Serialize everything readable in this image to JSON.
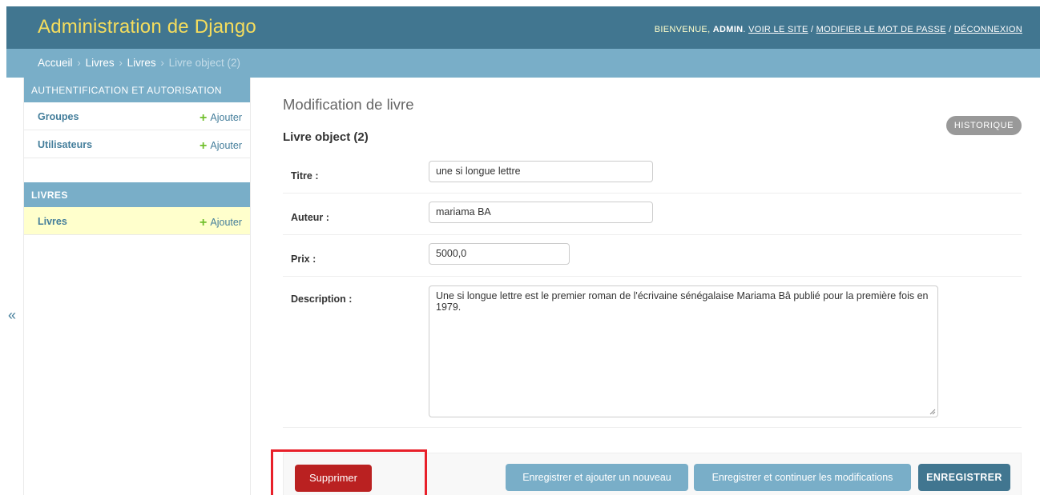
{
  "header": {
    "site_title": "Administration de Django",
    "welcome": "BIENVENUE, ",
    "user": "ADMIN",
    "view_site": "VOIR LE SITE",
    "change_password": "MODIFIER LE MOT DE PASSE",
    "logout": "DÉCONNEXION",
    "separator": " / ",
    "colors": {
      "bg": "#417690",
      "title": "#f5dd5d"
    }
  },
  "breadcrumbs": {
    "home": "Accueil",
    "app": "Livres",
    "model": "Livres",
    "current": "Livre object (2)",
    "sep": "›"
  },
  "sidebar": {
    "toggle_icon": "«",
    "modules": [
      {
        "caption": "AUTHENTIFICATION ET AUTORISATION",
        "models": [
          {
            "name": "Groupes",
            "add_label": "Ajouter"
          },
          {
            "name": "Utilisateurs",
            "add_label": "Ajouter"
          }
        ]
      },
      {
        "caption": "LIVRES",
        "models": [
          {
            "name": "Livres",
            "add_label": "Ajouter",
            "selected": true
          }
        ]
      }
    ]
  },
  "main": {
    "title": "Modification de livre",
    "object_title": "Livre object (2)",
    "history_label": "HISTORIQUE",
    "fields": [
      {
        "label": "Titre :",
        "value": "une si longue lettre"
      },
      {
        "label": "Auteur :",
        "value": "mariama BA"
      },
      {
        "label": "Prix :",
        "value": "5000,0"
      },
      {
        "label": "Description :",
        "value": "Une si longue lettre est le premier roman de l'écrivaine sénégalaise Mariama Bâ publié pour la première fois en 1979."
      }
    ]
  },
  "submit_row": {
    "delete_label": "Supprimer",
    "save_add_label": "Enregistrer et ajouter un nouveau",
    "save_continue_label": "Enregistrer et continuer les modifications",
    "save_label": "ENREGISTRER",
    "colors": {
      "delete": "#ba2121",
      "secondary": "#79aec8",
      "primary": "#417690",
      "highlight": "#e8202a"
    }
  }
}
